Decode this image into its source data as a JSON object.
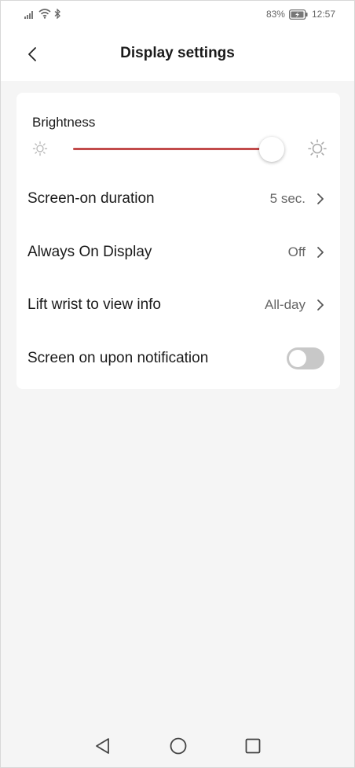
{
  "status_bar": {
    "signal_icon": "signal-icon",
    "wifi_icon": "wifi-icon",
    "bluetooth_icon": "bluetooth-icon",
    "battery_percent": "83%",
    "battery_icon": "battery-icon",
    "time": "12:57"
  },
  "header": {
    "back_icon": "chevron-left-icon",
    "title": "Display settings"
  },
  "brightness": {
    "label": "Brightness",
    "level": 0.94,
    "track_color": "#c24a4a",
    "min_icon": "sun-small-icon",
    "max_icon": "sun-large-icon"
  },
  "settings": [
    {
      "label": "Screen-on duration",
      "value": "5 sec."
    },
    {
      "label": "Always On Display",
      "value": "Off"
    },
    {
      "label": "Lift wrist to view info",
      "value": "All-day"
    },
    {
      "label": "Screen on upon notification",
      "toggle": false
    }
  ],
  "nav": {
    "back": "triangle-back-icon",
    "home": "circle-home-icon",
    "recents": "square-recents-icon"
  }
}
